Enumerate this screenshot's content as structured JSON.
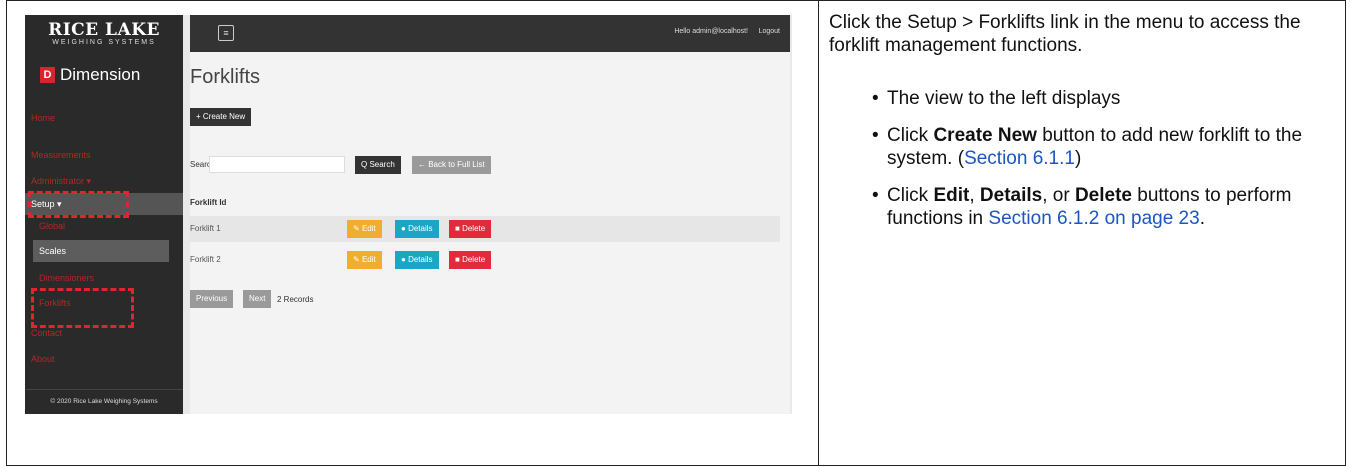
{
  "screenshot": {
    "logo": {
      "main": "RICE LAKE",
      "sub": "WEIGHING SYSTEMS"
    },
    "product": {
      "mark": "D",
      "name": "Dimension"
    },
    "nav": {
      "home": "Home",
      "measurements": "Measurements",
      "administrator": "Administrator ▾",
      "setup": "Setup ▾",
      "global": "Global",
      "scales": "Scales",
      "dimensioners": "Dimensioners",
      "forklifts": "Forklifts",
      "contact": "Contact",
      "about": "About"
    },
    "footer": "© 2020 Rice Lake Weighing Systems",
    "topbar": {
      "menu_icon": "≡",
      "user": "Hello admin@localhost!",
      "logout": "Logout"
    },
    "page_title": "Forklifts",
    "create_new": "+ Create New",
    "search_label": "Search",
    "search_button": "Q Search",
    "back_button": "← Back to Full List",
    "column_header": "Forklift Id",
    "rows": [
      {
        "id": "Forklift 1"
      },
      {
        "id": "Forklift 2"
      }
    ],
    "row_buttons": {
      "edit": "Edit",
      "details": "Details",
      "delete": "Delete"
    },
    "pager": {
      "previous": "Previous",
      "next": "Next",
      "records": "2 Records"
    }
  },
  "instructions": {
    "intro": "Click the Setup > Forklifts link in the menu to access the forklift management functions.",
    "b1": "The view to the left displays",
    "b2_pre": "Click ",
    "b2_bold": "Create New",
    "b2_mid": " button to add new forklift to the system. (",
    "b2_link": "Section 6.1.1",
    "b2_post": ")",
    "b3_pre": "Click ",
    "b3_bold1": "Edit",
    "b3_sep1": ", ",
    "b3_bold2": "Details",
    "b3_sep2": ", or ",
    "b3_bold3": "Delete",
    "b3_mid": " buttons to perform functions in ",
    "b3_link": "Section 6.1.2 on page 23",
    "b3_post": "."
  },
  "colors": {
    "accent_red": "#e0252f",
    "link": "#1a56c4"
  }
}
